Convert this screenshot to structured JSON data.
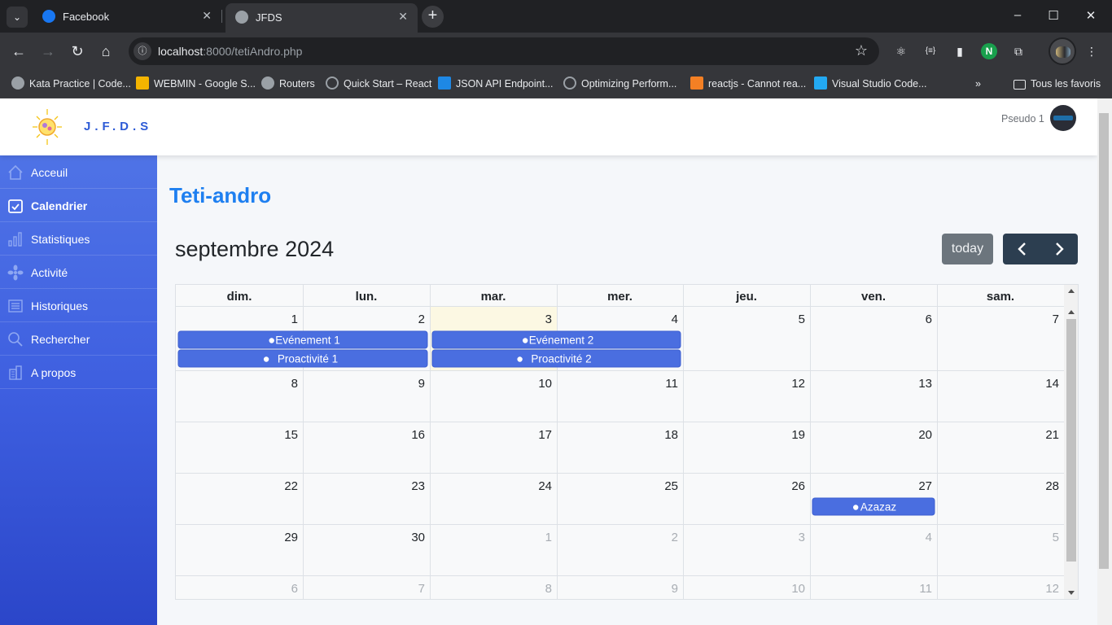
{
  "browser": {
    "tabs": [
      {
        "title": "Facebook",
        "active": false
      },
      {
        "title": "JFDS",
        "active": true
      }
    ],
    "url_host": "localhost",
    "url_path": ":8000/tetiAndro.php",
    "bookmarks": [
      "Kata Practice | Code...",
      "WEBMIN - Google S...",
      "Routers",
      "Quick Start – React",
      "JSON API Endpoint...",
      "Optimizing Perform...",
      "reactjs - Cannot rea...",
      "Visual Studio Code..."
    ],
    "all_bookmarks": "Tous les favoris"
  },
  "header": {
    "brand": "J.F.D.S",
    "user": "Pseudo 1"
  },
  "sidebar": {
    "items": [
      {
        "label": "Acceuil",
        "icon": "home-icon",
        "active": false
      },
      {
        "label": "Calendrier",
        "icon": "calendar-check-icon",
        "active": true
      },
      {
        "label": "Statistiques",
        "icon": "bar-chart-icon",
        "active": false
      },
      {
        "label": "Activité",
        "icon": "pinwheel-icon",
        "active": false
      },
      {
        "label": "Historiques",
        "icon": "list-icon",
        "active": false
      },
      {
        "label": "Rechercher",
        "icon": "search-icon",
        "active": false
      },
      {
        "label": "A propos",
        "icon": "building-icon",
        "active": false
      }
    ]
  },
  "main": {
    "title": "Teti-andro"
  },
  "calendar": {
    "title": "septembre 2024",
    "today_label": "today",
    "weekdays": [
      "dim.",
      "lun.",
      "mar.",
      "mer.",
      "jeu.",
      "ven.",
      "sam."
    ],
    "weeks": [
      [
        1,
        2,
        3,
        4,
        5,
        6,
        7
      ],
      [
        8,
        9,
        10,
        11,
        12,
        13,
        14
      ],
      [
        15,
        16,
        17,
        18,
        19,
        20,
        21
      ],
      [
        22,
        23,
        24,
        25,
        26,
        27,
        28
      ],
      [
        29,
        30,
        1,
        2,
        3,
        4,
        5
      ],
      [
        6,
        7,
        8,
        9,
        10,
        11,
        12
      ]
    ],
    "today_day": 3,
    "events": [
      {
        "title": "Evénement 1",
        "start": "2024-09-01",
        "end": "2024-09-02"
      },
      {
        "title": "Proactivité 1",
        "start": "2024-09-01",
        "end": "2024-09-02"
      },
      {
        "title": "Evénement 2",
        "start": "2024-09-03",
        "end": "2024-09-04"
      },
      {
        "title": "Proactivité 2",
        "start": "2024-09-03",
        "end": "2024-09-04"
      },
      {
        "title": "Azazaz",
        "start": "2024-09-27",
        "end": "2024-09-27"
      }
    ],
    "event_color": "#4a6ee0",
    "today_bg": "#fcf8e3"
  }
}
